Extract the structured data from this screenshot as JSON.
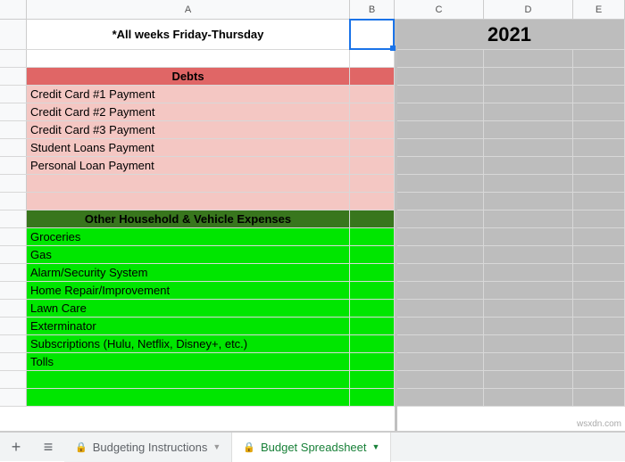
{
  "columns": {
    "A": "A",
    "B": "B",
    "C": "C",
    "D": "D",
    "E": "E"
  },
  "header": {
    "note": "*All weeks Friday-Thursday",
    "year": "2021"
  },
  "sections": {
    "debts": {
      "title": "Debts",
      "items": [
        "Credit Card #1 Payment",
        "Credit Card #2 Payment",
        "Credit Card #3 Payment",
        "Student Loans Payment",
        "Personal Loan Payment"
      ]
    },
    "household": {
      "title": "Other Household & Vehicle Expenses",
      "items": [
        "Groceries",
        "Gas",
        "Alarm/Security System",
        "Home Repair/Improvement",
        "Lawn Care",
        "Exterminator",
        "Subscriptions (Hulu, Netflix, Disney+, etc.)",
        "Tolls"
      ]
    }
  },
  "tabs": {
    "budgeting": "Budgeting Instructions",
    "spreadsheet": "Budget Spreadsheet"
  },
  "watermark": "wsxdn.com",
  "colors": {
    "gray": "#bdbdbd",
    "salmon": "#e06666",
    "pink": "#f4c7c3",
    "darkgreen": "#38761d",
    "brightgreen": "#00e600",
    "selection": "#1a73e8",
    "tabgreen": "#188038"
  },
  "chart_data": {
    "type": "table",
    "title": "2021",
    "note": "*All weeks Friday-Thursday",
    "sections": [
      {
        "name": "Debts",
        "rows": [
          "Credit Card #1 Payment",
          "Credit Card #2 Payment",
          "Credit Card #3 Payment",
          "Student Loans Payment",
          "Personal Loan Payment"
        ]
      },
      {
        "name": "Other Household & Vehicle Expenses",
        "rows": [
          "Groceries",
          "Gas",
          "Alarm/Security System",
          "Home Repair/Improvement",
          "Lawn Care",
          "Exterminator",
          "Subscriptions (Hulu, Netflix, Disney+, etc.)",
          "Tolls"
        ]
      }
    ]
  }
}
